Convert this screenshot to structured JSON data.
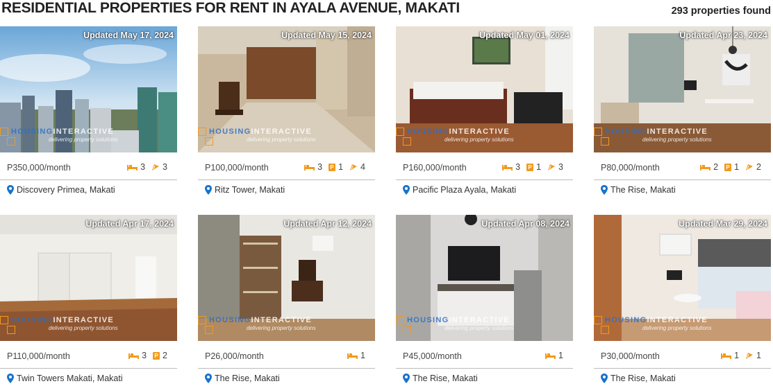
{
  "header": {
    "title": "RESIDENTIAL PROPERTIES FOR RENT IN AYALA AVENUE, MAKATI",
    "count": "293 properties found"
  },
  "watermark": {
    "brand_a": "HOUSING",
    "brand_b": "INTERACTIVE",
    "tagline": "delivering property solutions"
  },
  "colors": {
    "accent": "#f29a1d",
    "pin": "#1a73c9"
  },
  "listings": [
    {
      "updated": "Updated May 17, 2024",
      "price": "P350,000/month",
      "beds": "3",
      "parking": "",
      "baths": "3",
      "location": "Discovery Primea, Makati",
      "photo": "city-skyline"
    },
    {
      "updated": "Updated May 15, 2024",
      "price": "P100,000/month",
      "beds": "3",
      "parking": "1",
      "baths": "4",
      "location": "Ritz Tower, Makati",
      "photo": "hallway"
    },
    {
      "updated": "Updated May 01, 2024",
      "price": "P160,000/month",
      "beds": "3",
      "parking": "1",
      "baths": "3",
      "location": "Pacific Plaza Ayala, Makati",
      "photo": "bedroom"
    },
    {
      "updated": "Updated Apr 23, 2024",
      "price": "P80,000/month",
      "beds": "2",
      "parking": "1",
      "baths": "2",
      "location": "The Rise, Makati",
      "photo": "living-room"
    },
    {
      "updated": "Updated Apr 17, 2024",
      "price": "P110,000/month",
      "beds": "3",
      "parking": "2",
      "baths": "",
      "location": "Twin Towers Makati, Makati",
      "photo": "empty-room"
    },
    {
      "updated": "Updated Apr 12, 2024",
      "price": "P26,000/month",
      "beds": "1",
      "parking": "",
      "baths": "",
      "location": "The Rise, Makati",
      "photo": "shelves"
    },
    {
      "updated": "Updated Apr 08, 2024",
      "price": "P45,000/month",
      "beds": "1",
      "parking": "",
      "baths": "",
      "location": "The Rise, Makati",
      "photo": "kitchen-tv"
    },
    {
      "updated": "Updated Mar 29, 2024",
      "price": "P30,000/month",
      "beds": "1",
      "parking": "",
      "baths": "1",
      "location": "The Rise, Makati",
      "photo": "dining-nook"
    }
  ]
}
